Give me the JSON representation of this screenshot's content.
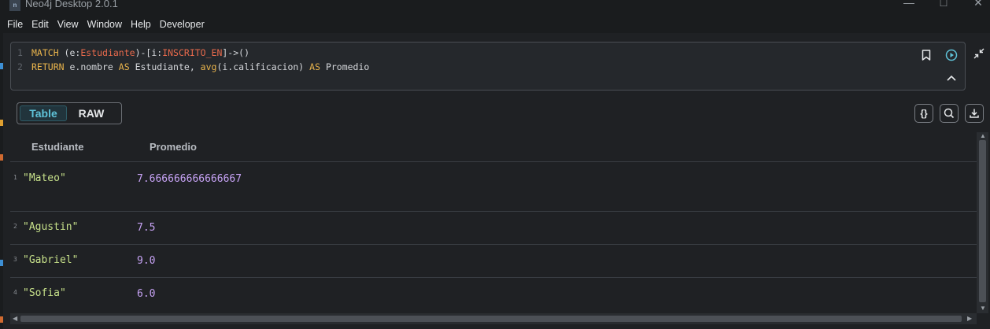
{
  "window": {
    "title": "Neo4j Desktop 2.0.1",
    "app_icon_text": "n"
  },
  "menu": [
    "File",
    "Edit",
    "View",
    "Window",
    "Help",
    "Developer"
  ],
  "editor": {
    "line1_no": "1",
    "line2_no": "2",
    "l1_kw": "MATCH",
    "l1_a": " (e:",
    "l1_label1": "Estudiante",
    "l1_b": ")-[i:",
    "l1_label2": "INSCRITO_EN",
    "l1_c": "]->()",
    "l2_kw": "RETURN",
    "l2_a": " e.nombre ",
    "l2_as1": "AS",
    "l2_b": " Estudiante, ",
    "l2_fn": "avg",
    "l2_c": "(i.calificacion) ",
    "l2_as2": "AS",
    "l2_d": " Promedio"
  },
  "view_tabs": {
    "table": "Table",
    "raw": "RAW"
  },
  "toolbar": {
    "json_label": "{}"
  },
  "table": {
    "columns": [
      "Estudiante",
      "Promedio"
    ],
    "rows": [
      {
        "num": "1",
        "estudiante": "\"Mateo\"",
        "promedio": "7.666666666666667"
      },
      {
        "num": "2",
        "estudiante": "\"Agustin\"",
        "promedio": "7.5"
      },
      {
        "num": "3",
        "estudiante": "\"Gabriel\"",
        "promedio": "9.0"
      },
      {
        "num": "4",
        "estudiante": "\"Sofia\"",
        "promedio": "6.0"
      }
    ]
  },
  "colors": {
    "accent": "#5fc3d9",
    "keyword": "#e9b44c",
    "label": "#e86a4c",
    "string": "#c6e08a",
    "number": "#c7a3f5"
  }
}
